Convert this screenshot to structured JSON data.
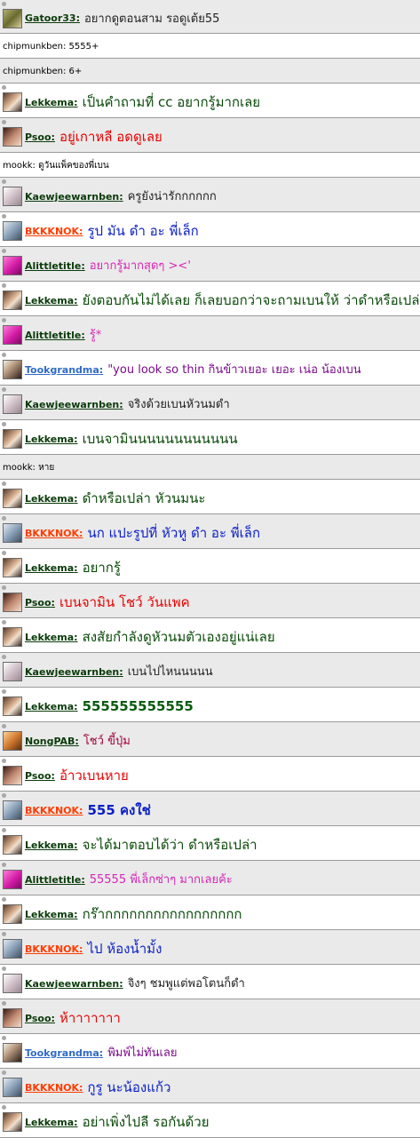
{
  "messages": [
    {
      "kind": "user",
      "user": "Gatoor33",
      "avatar": "gator",
      "name_color": "green",
      "text": "อยากดูตอนสาม รอดูเต้ย55",
      "text_color": "black",
      "bg": "alt",
      "first": true
    },
    {
      "kind": "plain",
      "text": "chipmunkben: 5555+",
      "bg": "white"
    },
    {
      "kind": "plain",
      "text": "chipmunkben: 6+",
      "bg": "alt"
    },
    {
      "kind": "user",
      "user": "Lekkema",
      "avatar": "lekkema",
      "name_color": "green",
      "text": "เป็นคำถามที่ cc อยากรู้มากเลย",
      "text_color": "green",
      "big": true,
      "bg": "white"
    },
    {
      "kind": "user",
      "user": "Psoo",
      "avatar": "psoo",
      "name_color": "green",
      "text": "อยู่เกาหลี อดดูเลย",
      "text_color": "red",
      "big": true,
      "bg": "alt"
    },
    {
      "kind": "plain",
      "text": "mookk: ดูวันแพ็คของพี่เบน",
      "bg": "white"
    },
    {
      "kind": "user",
      "user": "Kaewjeewarnben",
      "avatar": "kaew",
      "name_color": "green",
      "text": "ครูยังน่ารักกกกกก",
      "text_color": "black",
      "bg": "alt"
    },
    {
      "kind": "user",
      "user": "BKKKNOK",
      "avatar": "bkk",
      "name_color": "red",
      "text": "รูป มัน ดำ อะ พี่เล็ก",
      "text_color": "blue",
      "big": true,
      "bg": "white"
    },
    {
      "kind": "user",
      "user": "Alittletitle",
      "avatar": "alittle",
      "name_color": "green",
      "text": "อยากรู้มากสุดๆ ><'",
      "text_color": "pink",
      "bg": "alt"
    },
    {
      "kind": "user",
      "user": "Lekkema",
      "avatar": "lekkema",
      "name_color": "green",
      "text": "ยังตอบกันไม่ได้เลย ก็เลยบอกว่าจะถามเบนให้ ว่าดำหรือเปล่า",
      "text_color": "green",
      "big": true,
      "bg": "white"
    },
    {
      "kind": "user",
      "user": "Alittletitle",
      "avatar": "alittle",
      "name_color": "green",
      "text": "รู้*",
      "text_color": "pink",
      "bg": "alt"
    },
    {
      "kind": "user",
      "user": "Tookgrandma",
      "avatar": "took",
      "name_color": "blue",
      "text": "\"you look so thin  กินข้าวเยอะ เยอะ เน่อ น้องเบน",
      "text_color": "purple",
      "bg": "white"
    },
    {
      "kind": "user",
      "user": "Kaewjeewarnben",
      "avatar": "kaew",
      "name_color": "green",
      "text": "จริงด้วยเบนหัวนมดำ",
      "text_color": "black",
      "bg": "alt"
    },
    {
      "kind": "user",
      "user": "Lekkema",
      "avatar": "lekkema",
      "name_color": "green",
      "text": "เบนจามินนนนนนนนนนนน",
      "text_color": "green",
      "big": true,
      "bg": "white"
    },
    {
      "kind": "plain",
      "text": "mookk: หาย",
      "bg": "alt"
    },
    {
      "kind": "user",
      "user": "Lekkema",
      "avatar": "lekkema",
      "name_color": "green",
      "text": "ดำหรือเปล่า หัวนมนะ",
      "text_color": "green",
      "big": true,
      "bg": "white"
    },
    {
      "kind": "user",
      "user": "BKKKNOK",
      "avatar": "bkk",
      "name_color": "red",
      "text": "นก แปะรูปที่ หัวหู ดำ อะ พี่เล็ก",
      "text_color": "blue",
      "big": true,
      "bg": "alt"
    },
    {
      "kind": "user",
      "user": "Lekkema",
      "avatar": "lekkema",
      "name_color": "green",
      "text": "อยากรู้",
      "text_color": "green",
      "big": true,
      "bg": "white"
    },
    {
      "kind": "user",
      "user": "Psoo",
      "avatar": "psoo",
      "name_color": "green",
      "text": "เบนจามิน โชว์ วันแพค",
      "text_color": "red",
      "big": true,
      "bg": "alt"
    },
    {
      "kind": "user",
      "user": "Lekkema",
      "avatar": "lekkema",
      "name_color": "green",
      "text": "สงสัยกำลังดูหัวนมตัวเองอยู่แน่เลย",
      "text_color": "green",
      "big": true,
      "bg": "white"
    },
    {
      "kind": "user",
      "user": "Kaewjeewarnben",
      "avatar": "kaew",
      "name_color": "green",
      "text": "เบนไปไหนนนนน",
      "text_color": "black",
      "bg": "alt"
    },
    {
      "kind": "user",
      "user": "Lekkema",
      "avatar": "lekkema",
      "name_color": "green",
      "text": "555555555555",
      "text_color": "darkgreen",
      "big": true,
      "bold": true,
      "bg": "white"
    },
    {
      "kind": "user",
      "user": "NongPAB",
      "avatar": "nong",
      "name_color": "green",
      "text": "โชว์ ขี้ปุ่ม",
      "text_color": "maroon",
      "bg": "alt"
    },
    {
      "kind": "user",
      "user": "Psoo",
      "avatar": "psoo",
      "name_color": "green",
      "text": "อ้าวเบนหาย",
      "text_color": "red",
      "big": true,
      "bg": "white"
    },
    {
      "kind": "user",
      "user": "BKKKNOK",
      "avatar": "bkk",
      "name_color": "red",
      "text": "555  คงใช่",
      "text_color": "blue",
      "big": true,
      "bold": true,
      "bg": "alt"
    },
    {
      "kind": "user",
      "user": "Lekkema",
      "avatar": "lekkema",
      "name_color": "green",
      "text": "จะได้มาตอบได้ว่า ดำหรือเปล่า",
      "text_color": "green",
      "big": true,
      "bg": "white"
    },
    {
      "kind": "user",
      "user": "Alittletitle",
      "avatar": "alittle",
      "name_color": "green",
      "text": "55555 พี่เล็กซ่าๆ มากเลยค้ะ",
      "text_color": "pink",
      "bg": "alt"
    },
    {
      "kind": "user",
      "user": "Lekkema",
      "avatar": "lekkema",
      "name_color": "green",
      "text": "กร๊ากกกกกกกกกกกกกกกกก",
      "text_color": "green",
      "big": true,
      "bg": "white"
    },
    {
      "kind": "user",
      "user": "BKKKNOK",
      "avatar": "bkk",
      "name_color": "red",
      "text": "ไป ห้องน้ำมั้ง",
      "text_color": "blue",
      "big": true,
      "bg": "alt"
    },
    {
      "kind": "user",
      "user": "Kaewjeewarnben",
      "avatar": "kaew",
      "name_color": "green",
      "text": "จิงๆ ชมพูแต่พอโตนก็ดำ",
      "text_color": "black",
      "bg": "white"
    },
    {
      "kind": "user",
      "user": "Psoo",
      "avatar": "psoo",
      "name_color": "green",
      "text": "ห้าาาาาาา",
      "text_color": "red",
      "big": true,
      "bg": "alt"
    },
    {
      "kind": "user",
      "user": "Tookgrandma",
      "avatar": "took",
      "name_color": "blue",
      "text": "พิมพ์ไม่ทันเลย",
      "text_color": "purple",
      "bg": "white"
    },
    {
      "kind": "user",
      "user": "BKKKNOK",
      "avatar": "bkk",
      "name_color": "red",
      "text": "กูรู นะน้องแก้ว",
      "text_color": "blue",
      "big": true,
      "bg": "alt"
    },
    {
      "kind": "user",
      "user": "Lekkema",
      "avatar": "lekkema",
      "name_color": "green",
      "text": "อย่าเพิ่งไปลี รอกันด้วย",
      "text_color": "green",
      "big": true,
      "bg": "white"
    }
  ],
  "name_suffix": ":"
}
